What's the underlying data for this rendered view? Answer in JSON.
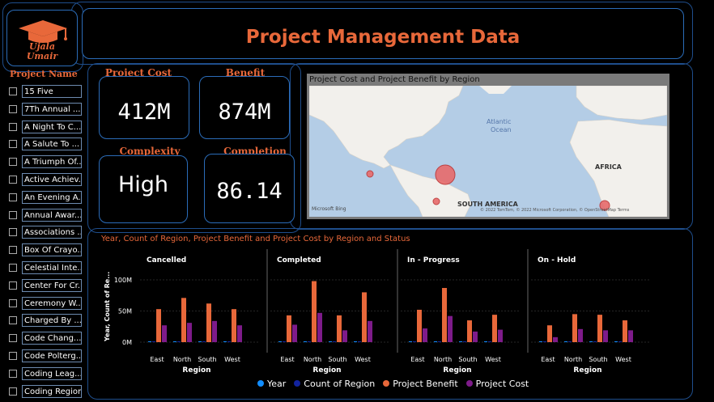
{
  "logo": {
    "line1": "Ujala",
    "line2": "Umair"
  },
  "header": {
    "title": "Project Management Data"
  },
  "kpis": {
    "project_cost": {
      "label": "Project Cost",
      "value": "412M"
    },
    "benefit": {
      "label": "Benefit",
      "value": "874M"
    },
    "complexity": {
      "label": "Complexity",
      "value": "High"
    },
    "completion": {
      "label": "Completion",
      "value": "86.14"
    }
  },
  "slicer": {
    "title": "Project Name",
    "items": [
      "15 Five",
      "7Th Annual ...",
      "A Night To C...",
      "A Salute To ...",
      "A Triumph Of...",
      "Active Achiev...",
      "An Evening A...",
      "Annual Awar...",
      "Associations ...",
      "Box Of Crayo...",
      "Celestial Inte...",
      "Center For Cr...",
      "Ceremony W...",
      "Charged By ...",
      "Code Chang...",
      "Code Polterg...",
      "Coding Leag...",
      "Coding Region"
    ]
  },
  "map": {
    "title": "Project Cost and Project Benefit by Region",
    "labels": {
      "ocean": "Atlantic",
      "ocean2": "Ocean",
      "africa": "AFRICA",
      "sa": "SOUTH AMERICA"
    },
    "brand": "Microsoft Bing",
    "copyright": "© 2022 TomTom, © 2022 Microsoft Corporation, © OpenStreetMap  Terms"
  },
  "colors": {
    "accent": "#e8683a",
    "border": "#2b6cb8",
    "benefit": "#e8683a",
    "cost": "#7e1b8a",
    "year": "#118dff",
    "count": "#12239e"
  },
  "chart_title": "Year, Count of Region, Project Benefit and Project Cost by Region and Status",
  "chart_data": {
    "type": "bar",
    "title": "Year, Count of Region, Project Benefit and Project Cost by Region and Status",
    "ylabel": "Year, Count of Re...",
    "xlabel": "Region",
    "yticks": [
      "100M",
      "50M",
      "0M"
    ],
    "ylim": [
      0,
      110
    ],
    "categories": [
      "East",
      "North",
      "South",
      "West"
    ],
    "facets": [
      {
        "name": "Cancelled",
        "series": [
          {
            "name": "Project Benefit",
            "values": [
              53,
              71,
              62,
              53
            ]
          },
          {
            "name": "Project Cost",
            "values": [
              27,
              31,
              34,
              27
            ]
          }
        ]
      },
      {
        "name": "Completed",
        "series": [
          {
            "name": "Project Benefit",
            "values": [
              43,
              98,
              43,
              80
            ]
          },
          {
            "name": "Project Cost",
            "values": [
              28,
              47,
              19,
              34
            ]
          }
        ]
      },
      {
        "name": "In - Progress",
        "series": [
          {
            "name": "Project Benefit",
            "values": [
              52,
              87,
              35,
              44
            ]
          },
          {
            "name": "Project Cost",
            "values": [
              22,
              42,
              17,
              20
            ]
          }
        ]
      },
      {
        "name": "On - Hold",
        "series": [
          {
            "name": "Project Benefit",
            "values": [
              27,
              45,
              44,
              35
            ]
          },
          {
            "name": "Project Cost",
            "values": [
              8,
              21,
              19,
              19
            ]
          }
        ]
      }
    ],
    "legend": [
      "Year",
      "Count of Region",
      "Project Benefit",
      "Project Cost"
    ]
  }
}
